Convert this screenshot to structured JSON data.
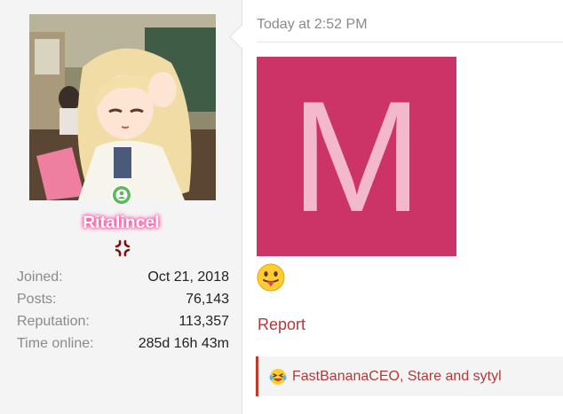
{
  "user": {
    "username": "RitaIincel",
    "avatar_icon": "anime-girl-avatar",
    "online_icon": "user-online-icon",
    "rank_icon": "anger-symbol-icon",
    "stats": [
      {
        "label": "Joined:",
        "value": "Oct 21, 2018"
      },
      {
        "label": "Posts:",
        "value": "76,143"
      },
      {
        "label": "Reputation:",
        "value": "113,357"
      },
      {
        "label": "Time online:",
        "value": "285d 16h 43m"
      }
    ]
  },
  "post": {
    "timestamp": "Today at 2:52 PM",
    "image_letter": "M",
    "emoji_icon": "tongue-out-emoji",
    "report_label": "Report",
    "reactions": {
      "icon": "laughing-crying-emoji",
      "text": "FastBananaCEO, Stare and sytyl"
    }
  },
  "colors": {
    "panel_bg": "#f4f4f4",
    "username_glow": "#ff3f9a",
    "image_bg": "#cc3366",
    "image_letter": "#f4b8cc",
    "link": "#b03a3a",
    "reaction_border": "#c0392b",
    "online_green": "#5cb85c"
  }
}
